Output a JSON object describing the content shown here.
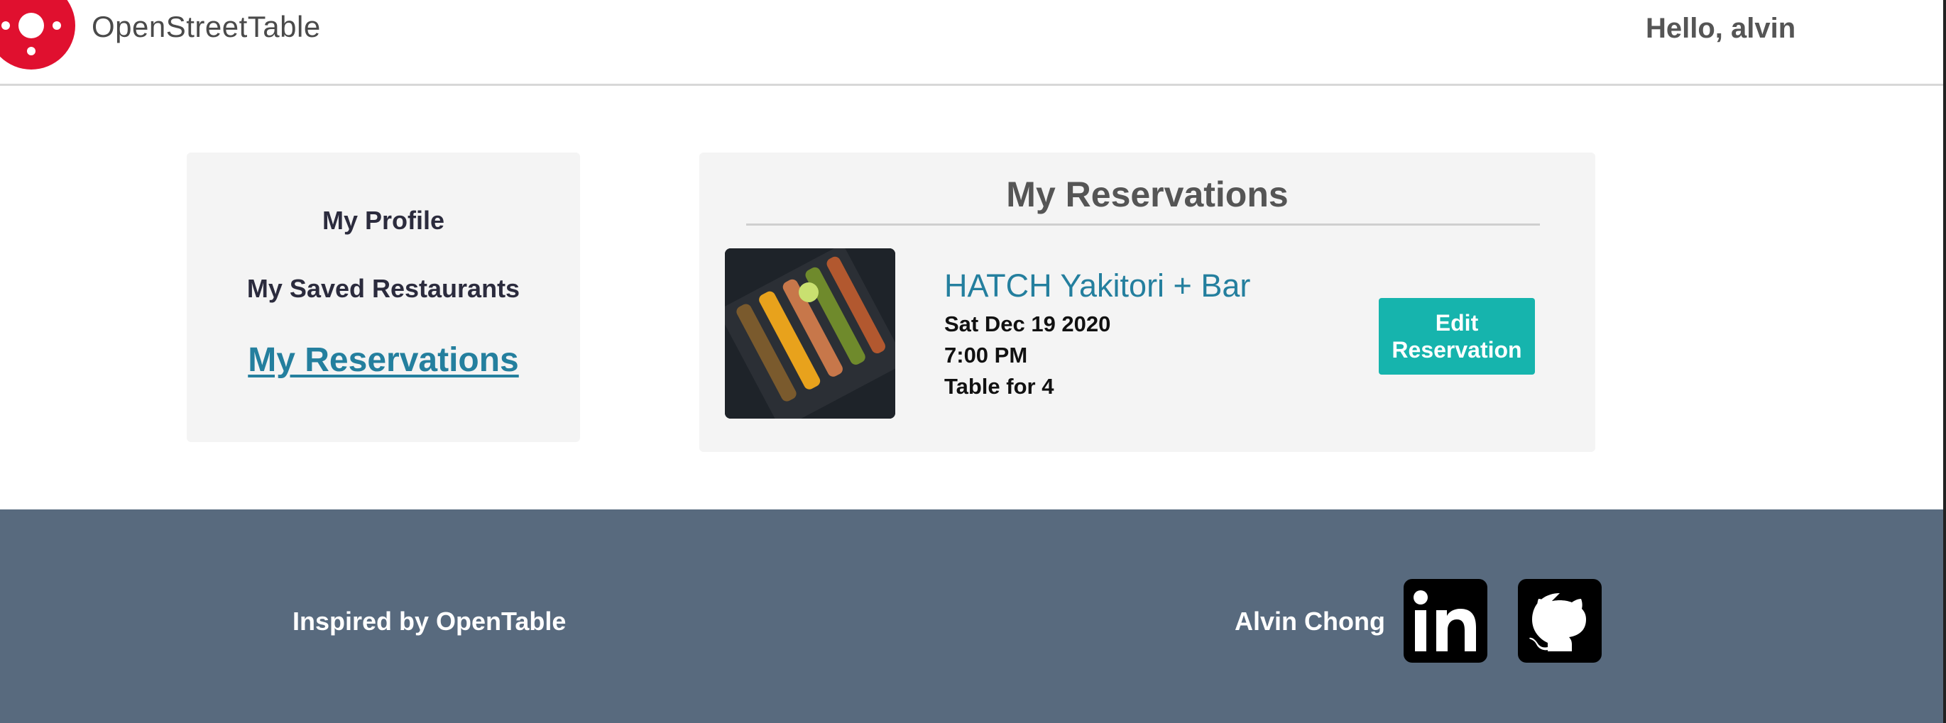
{
  "header": {
    "brand": "OpenStreetTable",
    "greeting": "Hello, alvin",
    "logo_color": "#e0102f"
  },
  "sidebar": {
    "items": [
      {
        "label": "My Profile",
        "active": false
      },
      {
        "label": "My Saved Restaurants",
        "active": false
      },
      {
        "label": "My Reservations",
        "active": true
      }
    ]
  },
  "reservations": {
    "title": "My Reservations",
    "items": [
      {
        "restaurant": "HATCH Yakitori + Bar",
        "date": "Sat Dec 19 2020",
        "time": "7:00 PM",
        "party": "Table for 4",
        "edit_label": "Edit Reservation"
      }
    ]
  },
  "footer": {
    "inspired": "Inspired by OpenTable",
    "author": "Alvin Chong",
    "links": [
      {
        "icon": "linkedin-icon"
      },
      {
        "icon": "github-icon"
      }
    ]
  },
  "colors": {
    "accent": "#16b4ad",
    "link": "#247f9e",
    "footer_bg": "#586a7e"
  }
}
